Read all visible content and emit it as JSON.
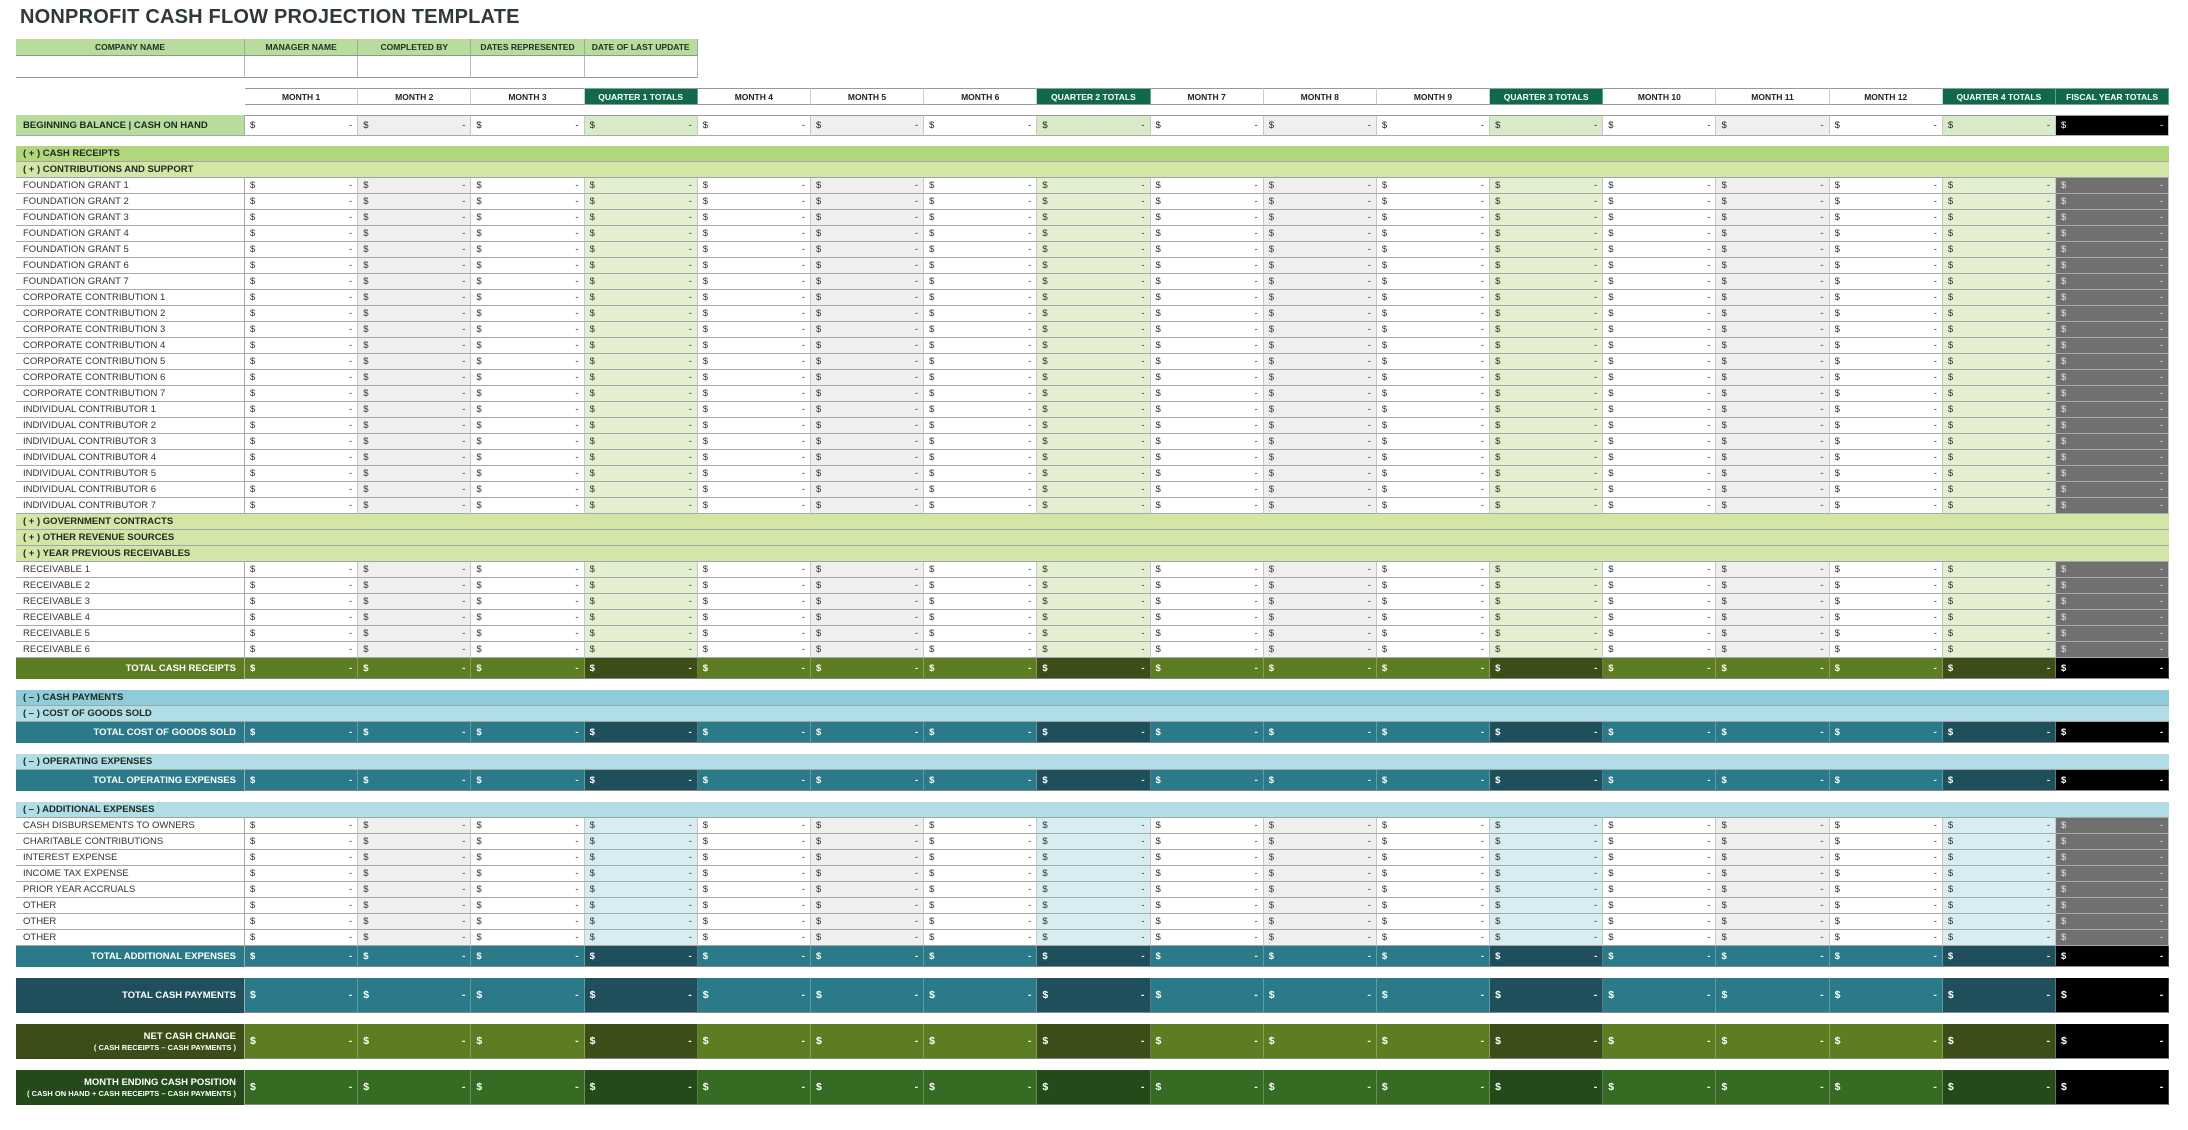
{
  "title": "NONPROFIT CASH FLOW PROJECTION TEMPLATE",
  "info_fields": [
    {
      "label": "COMPANY NAME",
      "value": ""
    },
    {
      "label": "MANAGER NAME",
      "value": ""
    },
    {
      "label": "COMPLETED BY",
      "value": ""
    },
    {
      "label": "DATES REPRESENTED",
      "value": ""
    },
    {
      "label": "DATE OF LAST UPDATE",
      "value": ""
    }
  ],
  "columns": [
    {
      "label": "MONTH 1",
      "type": "month",
      "shade": "white"
    },
    {
      "label": "MONTH 2",
      "type": "month",
      "shade": "grey"
    },
    {
      "label": "MONTH 3",
      "type": "month",
      "shade": "white"
    },
    {
      "label": "QUARTER 1 TOTALS",
      "type": "quarter"
    },
    {
      "label": "MONTH 4",
      "type": "month",
      "shade": "white"
    },
    {
      "label": "MONTH 5",
      "type": "month",
      "shade": "grey"
    },
    {
      "label": "MONTH 6",
      "type": "month",
      "shade": "white"
    },
    {
      "label": "QUARTER 2 TOTALS",
      "type": "quarter"
    },
    {
      "label": "MONTH 7",
      "type": "month",
      "shade": "white"
    },
    {
      "label": "MONTH 8",
      "type": "month",
      "shade": "grey"
    },
    {
      "label": "MONTH 9",
      "type": "month",
      "shade": "white"
    },
    {
      "label": "QUARTER 3 TOTALS",
      "type": "quarter"
    },
    {
      "label": "MONTH 10",
      "type": "month",
      "shade": "white"
    },
    {
      "label": "MONTH 11",
      "type": "month",
      "shade": "grey"
    },
    {
      "label": "MONTH 12",
      "type": "month",
      "shade": "white"
    },
    {
      "label": "QUARTER 4 TOTALS",
      "type": "quarter"
    },
    {
      "label": "FISCAL YEAR TOTALS",
      "type": "fiscal"
    }
  ],
  "currency_symbol": "$",
  "empty_value": "-",
  "beginning_balance": {
    "label": "BEGINNING BALANCE  |  CASH ON HAND"
  },
  "colors": {
    "header_green": "#10694a",
    "receipts_section": "#b2d67c",
    "receipts_subsection": "#d3e6a8",
    "receipts_total": "#5d7d22",
    "receipts_total_quarter": "#3c4d18",
    "payments_section": "#8fcbd8",
    "payments_subsection": "#b0dde6",
    "payments_total": "#2a7a8a",
    "payments_total_quarter": "#1f4f5a",
    "net_change": "#5d7d22",
    "net_change_quarter": "#3c4d18",
    "month_ending": "#356b22",
    "month_ending_quarter": "#234a18",
    "fiscal_total": "#000000"
  },
  "rows": [
    {
      "kind": "section",
      "label": "( + )  CASH RECEIPTS",
      "theme": "receipts_section"
    },
    {
      "kind": "section",
      "label": "( + )  CONTRIBUTIONS AND SUPPORT",
      "theme": "receipts_subsection"
    },
    {
      "kind": "data",
      "label": "FOUNDATION GRANT 1",
      "theme": "green"
    },
    {
      "kind": "data",
      "label": "FOUNDATION GRANT 2",
      "theme": "green"
    },
    {
      "kind": "data",
      "label": "FOUNDATION GRANT 3",
      "theme": "green"
    },
    {
      "kind": "data",
      "label": "FOUNDATION GRANT 4",
      "theme": "green"
    },
    {
      "kind": "data",
      "label": "FOUNDATION GRANT 5",
      "theme": "green"
    },
    {
      "kind": "data",
      "label": "FOUNDATION GRANT 6",
      "theme": "green"
    },
    {
      "kind": "data",
      "label": "FOUNDATION GRANT 7",
      "theme": "green"
    },
    {
      "kind": "data",
      "label": "CORPORATE CONTRIBUTION 1",
      "theme": "green"
    },
    {
      "kind": "data",
      "label": "CORPORATE CONTRIBUTION 2",
      "theme": "green"
    },
    {
      "kind": "data",
      "label": "CORPORATE CONTRIBUTION 3",
      "theme": "green"
    },
    {
      "kind": "data",
      "label": "CORPORATE CONTRIBUTION 4",
      "theme": "green"
    },
    {
      "kind": "data",
      "label": "CORPORATE CONTRIBUTION 5",
      "theme": "green"
    },
    {
      "kind": "data",
      "label": "CORPORATE CONTRIBUTION 6",
      "theme": "green"
    },
    {
      "kind": "data",
      "label": "CORPORATE CONTRIBUTION 7",
      "theme": "green"
    },
    {
      "kind": "data",
      "label": "INDIVIDUAL CONTRIBUTOR 1",
      "theme": "green"
    },
    {
      "kind": "data",
      "label": "INDIVIDUAL CONTRIBUTOR 2",
      "theme": "green"
    },
    {
      "kind": "data",
      "label": "INDIVIDUAL CONTRIBUTOR 3",
      "theme": "green"
    },
    {
      "kind": "data",
      "label": "INDIVIDUAL CONTRIBUTOR 4",
      "theme": "green"
    },
    {
      "kind": "data",
      "label": "INDIVIDUAL CONTRIBUTOR 5",
      "theme": "green"
    },
    {
      "kind": "data",
      "label": "INDIVIDUAL CONTRIBUTOR 6",
      "theme": "green"
    },
    {
      "kind": "data",
      "label": "INDIVIDUAL CONTRIBUTOR 7",
      "theme": "green"
    },
    {
      "kind": "section",
      "label": "( + )  GOVERNMENT CONTRACTS",
      "theme": "receipts_subsection"
    },
    {
      "kind": "section",
      "label": "( + )  OTHER REVENUE SOURCES",
      "theme": "receipts_subsection"
    },
    {
      "kind": "section",
      "label": "( + )  YEAR PREVIOUS RECEIVABLES",
      "theme": "receipts_subsection"
    },
    {
      "kind": "data",
      "label": "RECEIVABLE 1",
      "theme": "green"
    },
    {
      "kind": "data",
      "label": "RECEIVABLE 2",
      "theme": "green"
    },
    {
      "kind": "data",
      "label": "RECEIVABLE 3",
      "theme": "green"
    },
    {
      "kind": "data",
      "label": "RECEIVABLE 4",
      "theme": "green"
    },
    {
      "kind": "data",
      "label": "RECEIVABLE 5",
      "theme": "green"
    },
    {
      "kind": "data",
      "label": "RECEIVABLE 6",
      "theme": "green"
    },
    {
      "kind": "total",
      "label": "TOTAL CASH RECEIPTS",
      "theme": "receipts_total"
    },
    {
      "kind": "gap"
    },
    {
      "kind": "section",
      "label": "( – )  CASH PAYMENTS",
      "theme": "payments_section"
    },
    {
      "kind": "section",
      "label": "( – )  COST OF GOODS SOLD",
      "theme": "payments_subsection"
    },
    {
      "kind": "total",
      "label": "TOTAL COST OF GOODS SOLD",
      "theme": "payments_total"
    },
    {
      "kind": "gap"
    },
    {
      "kind": "section",
      "label": "( – )  OPERATING EXPENSES",
      "theme": "payments_subsection"
    },
    {
      "kind": "total",
      "label": "TOTAL OPERATING EXPENSES",
      "theme": "payments_total"
    },
    {
      "kind": "gap"
    },
    {
      "kind": "section",
      "label": "( – )  ADDITIONAL EXPENSES",
      "theme": "payments_subsection"
    },
    {
      "kind": "data",
      "label": "CASH DISBURSEMENTS TO OWNERS",
      "theme": "blue"
    },
    {
      "kind": "data",
      "label": "CHARITABLE CONTRIBUTIONS",
      "theme": "blue"
    },
    {
      "kind": "data",
      "label": "INTEREST EXPENSE",
      "theme": "blue"
    },
    {
      "kind": "data",
      "label": "INCOME TAX EXPENSE",
      "theme": "blue"
    },
    {
      "kind": "data",
      "label": "PRIOR YEAR ACCRUALS",
      "theme": "blue"
    },
    {
      "kind": "data",
      "label": "OTHER",
      "theme": "blue"
    },
    {
      "kind": "data",
      "label": "OTHER",
      "theme": "blue"
    },
    {
      "kind": "data",
      "label": "OTHER",
      "theme": "blue"
    },
    {
      "kind": "total",
      "label": "TOTAL ADDITIONAL EXPENSES",
      "theme": "payments_total"
    },
    {
      "kind": "gap"
    },
    {
      "kind": "bigtotal",
      "label": "TOTAL CASH PAYMENTS",
      "theme": "payments_total"
    },
    {
      "kind": "gap"
    },
    {
      "kind": "bigtotal",
      "label": "NET CASH CHANGE",
      "sublabel": "( CASH RECEIPTS – CASH PAYMENTS )",
      "theme": "net_change"
    },
    {
      "kind": "gap"
    },
    {
      "kind": "bigtotal",
      "label": "MONTH ENDING CASH POSITION",
      "sublabel": "( CASH ON HAND + CASH RECEIPTS – CASH PAYMENTS )",
      "theme": "month_ending"
    }
  ]
}
